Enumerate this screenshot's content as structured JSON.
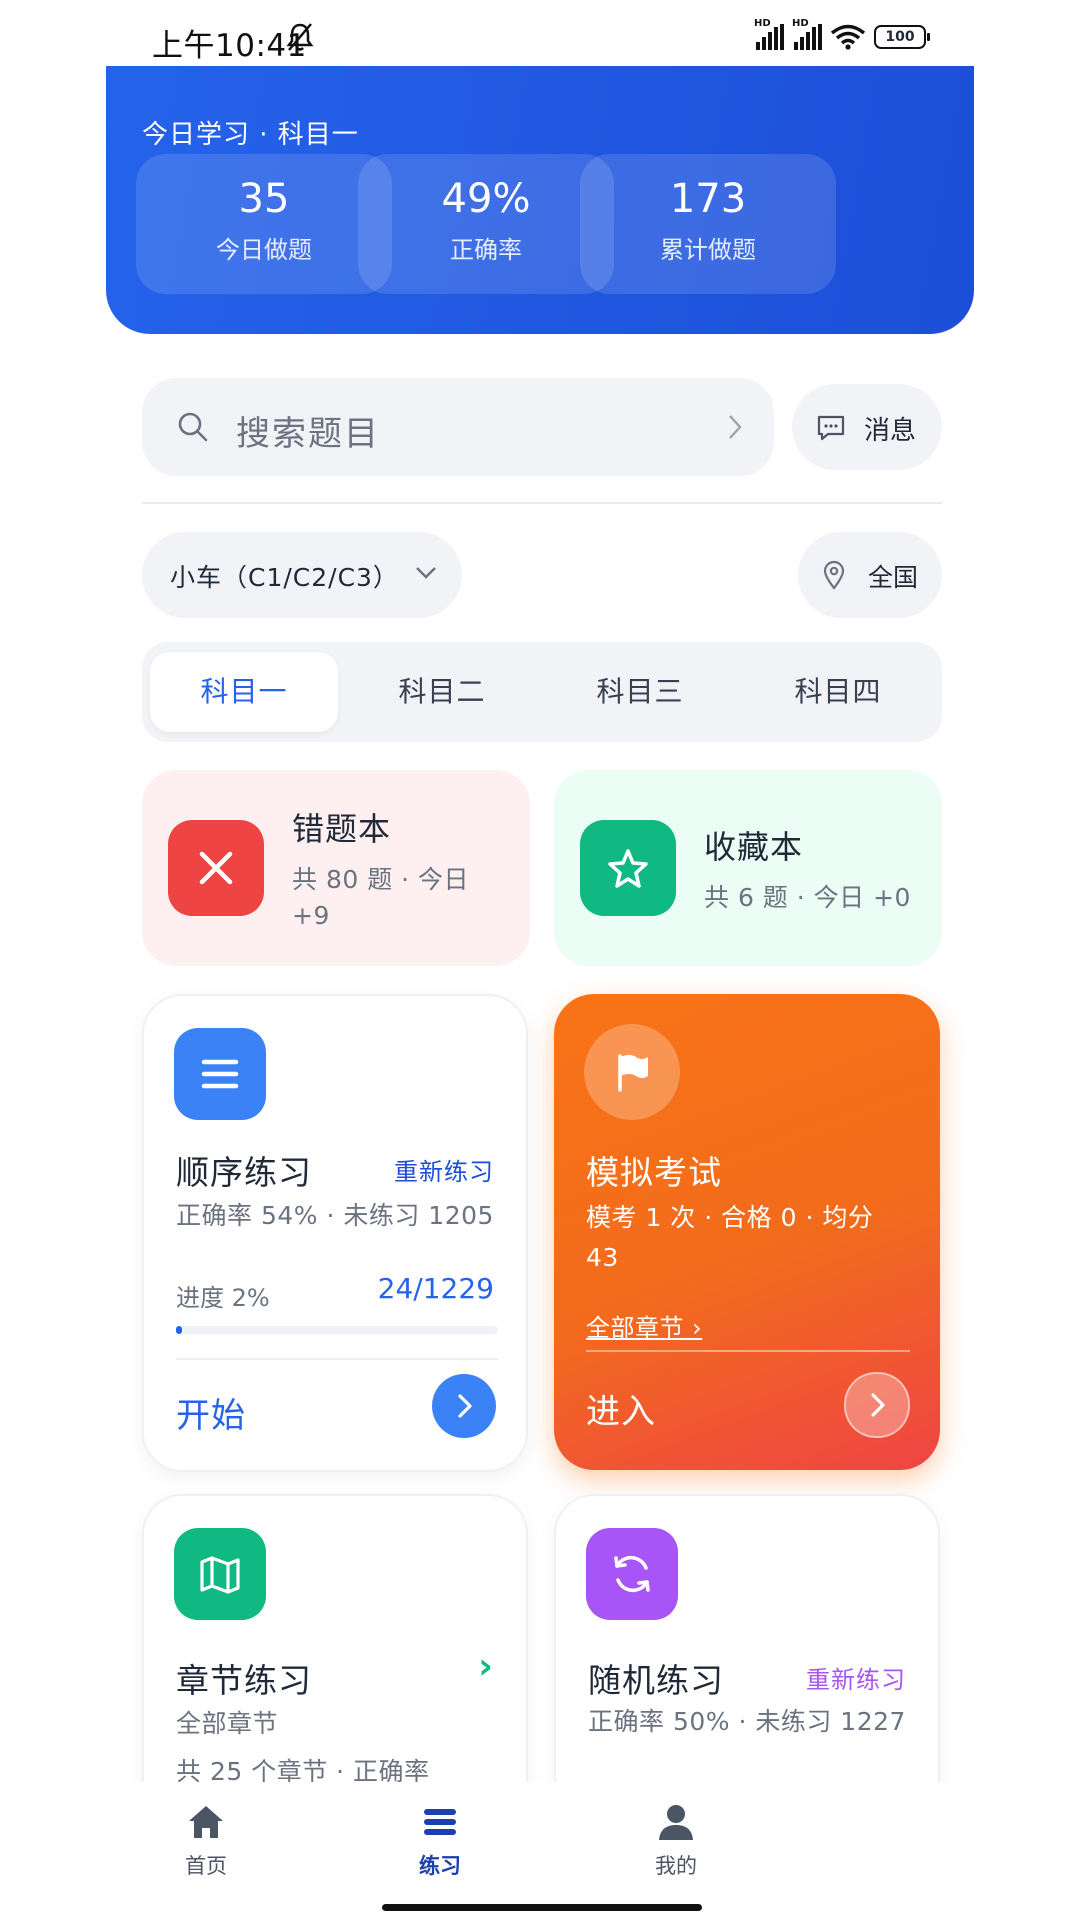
{
  "status_bar": {
    "time": "上午10:41",
    "signal_1": "HD",
    "signal_2": "HD",
    "battery": "100"
  },
  "header": {
    "title": "今日学习 · 科目一",
    "stats": [
      {
        "value": "35",
        "label": "今日做题"
      },
      {
        "value": "49%",
        "label": "正确率"
      },
      {
        "value": "173",
        "label": "累计做题"
      }
    ]
  },
  "search": {
    "placeholder": "搜索题目",
    "message_label": "消息"
  },
  "filters": {
    "license": "小车（C1/C2/C3）",
    "region": "全国"
  },
  "tabs": [
    {
      "label": "科目一",
      "active": true
    },
    {
      "label": "科目二",
      "active": false
    },
    {
      "label": "科目三",
      "active": false
    },
    {
      "label": "科目四",
      "active": false
    }
  ],
  "mistakes": {
    "title": "错题本",
    "subtitle_line1": "共 80 题 · 今日",
    "subtitle_line2": "+9",
    "icon": "x-icon",
    "color": "#ef4444"
  },
  "favorites": {
    "title": "收藏本",
    "subtitle": "共 6 题 · 今日 +0",
    "icon": "star-icon",
    "color": "#10b981"
  },
  "sequential": {
    "title": "顺序练习",
    "link": "重新练习",
    "subtitle": "正确率 54% · 未练习 1205",
    "progress_label": "进度 2%",
    "progress_value": "24/1229",
    "progress_fraction": 0.02,
    "start_label": "开始",
    "icon": "list-icon",
    "color": "#3b82f6"
  },
  "exam": {
    "title": "模拟考试",
    "subtitle_line1": "模考 1 次 · 合格 0 · 均分",
    "subtitle_line2": "43",
    "link": "全部章节 ›",
    "enter_label": "进入",
    "icon": "flag-icon"
  },
  "chapter": {
    "title": "章节练习",
    "arrow": "›",
    "subtitle": "全部章节",
    "detail": "共 25 个章节 · 正确率",
    "icon": "map-icon",
    "color": "#10b981"
  },
  "random": {
    "title": "随机练习",
    "link": "重新练习",
    "subtitle": "正确率 50% · 未练习 1227",
    "icon": "refresh-icon",
    "color": "#a855f7"
  },
  "bottom_nav": [
    {
      "label": "首页",
      "icon": "home-icon",
      "active": false
    },
    {
      "label": "练习",
      "icon": "practice-icon",
      "active": true
    },
    {
      "label": "我的",
      "icon": "profile-icon",
      "active": false
    }
  ],
  "colors": {
    "primary": "#2563eb",
    "accent_orange": "#f97316"
  }
}
